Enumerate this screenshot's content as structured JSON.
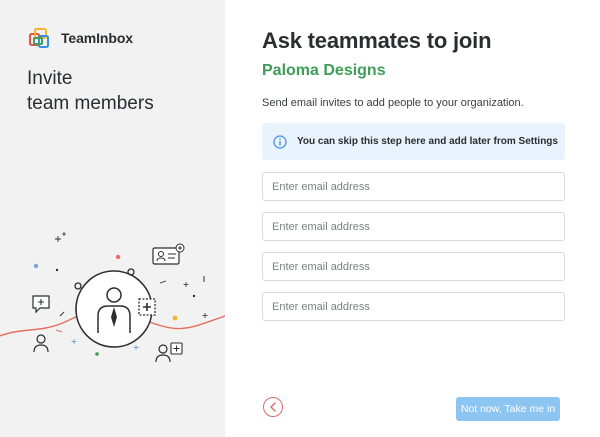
{
  "brand": {
    "name": "TeamInbox",
    "logo_icon": "teaminbox-logo"
  },
  "left_panel": {
    "heading_line1": "Invite",
    "heading_line2": "team members"
  },
  "main": {
    "title": "Ask teammates to join",
    "org_name": "Paloma Designs",
    "description": "Send email invites to add people to your organization.",
    "info": {
      "icon": "info-icon",
      "text": "You can skip this step here and add later from Settings"
    },
    "email_fields": [
      {
        "placeholder": "Enter email address",
        "value": ""
      },
      {
        "placeholder": "Enter email address",
        "value": ""
      },
      {
        "placeholder": "Enter email address",
        "value": ""
      },
      {
        "placeholder": "Enter email address",
        "value": ""
      }
    ]
  },
  "footer": {
    "back_icon": "chevron-left-icon",
    "skip_label": "Not now, Take me in"
  },
  "colors": {
    "accent_green": "#3f9d58",
    "info_bg": "#e9f3fd",
    "primary_button": "#8cc4f2",
    "back_button_border": "#e06b6b",
    "left_panel_bg": "#f2f2f3"
  }
}
